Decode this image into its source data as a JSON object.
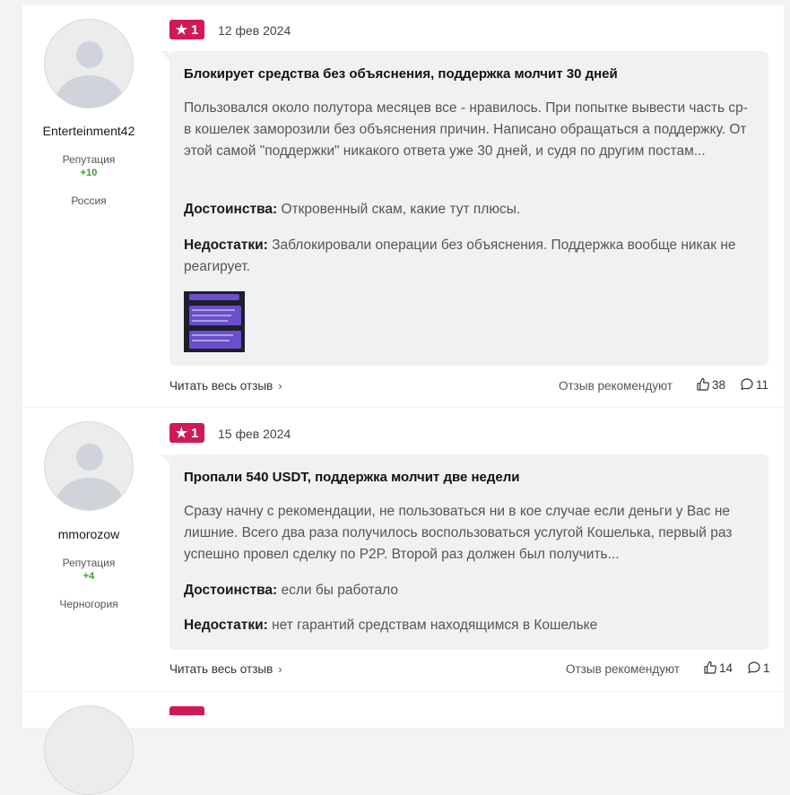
{
  "reviews": [
    {
      "author": "Enterteinment42",
      "reputation_label": "Репутация",
      "reputation_value": "+10",
      "country": "Россия",
      "rating": "1",
      "date": "12 фев 2024",
      "title": "Блокирует средства без объяснения, поддержка молчит 30 дней",
      "text": "Пользовался около полутора месяцев все - нравилось. При попытке вывести часть ср-в кошелек заморозили без объяснения причин. Написано обращаться а поддержку. От этой самой \"поддержки\" никакого ответа уже 30 дней, и судя по другим постам...",
      "pros_label": "Достоинства:",
      "pros": "Откровенный скам, какие тут плюсы.",
      "cons_label": "Недостатки:",
      "cons": "Заблокировали операции без объяснения. Поддержка вообще никак не реагирует.",
      "read_more": "Читать весь отзыв",
      "recommend_label": "Отзыв рекомендуют",
      "likes": "38",
      "comments": "11"
    },
    {
      "author": "mmorozow",
      "reputation_label": "Репутация",
      "reputation_value": "+4",
      "country": "Черногория",
      "rating": "1",
      "date": "15 фев 2024",
      "title": "Пропали 540 USDT, поддержка молчит две недели",
      "text": "Сразу начну с рекомендации, не пользоваться ни в кое случае если деньги у Вас не лишние. Всего два раза получилось воспользоваться услугой Кошелька, первый раз успешно провел сделку по P2P. Второй раз должен был получить...",
      "pros_label": "Достоинства:",
      "pros": "если бы работало",
      "cons_label": "Недостатки:",
      "cons": "нет гарантий средствам находящимся в Кошельке",
      "read_more": "Читать весь отзыв",
      "recommend_label": "Отзыв рекомендуют",
      "likes": "14",
      "comments": "1"
    }
  ],
  "icons": {
    "star": "star-icon",
    "thumb": "thumbs-up-icon",
    "comment": "comment-icon",
    "chevron": "chevron-right-icon"
  },
  "colors": {
    "badge": "#d0195a",
    "reputation": "#3a9b2c",
    "bubble": "#f0f1f3"
  }
}
